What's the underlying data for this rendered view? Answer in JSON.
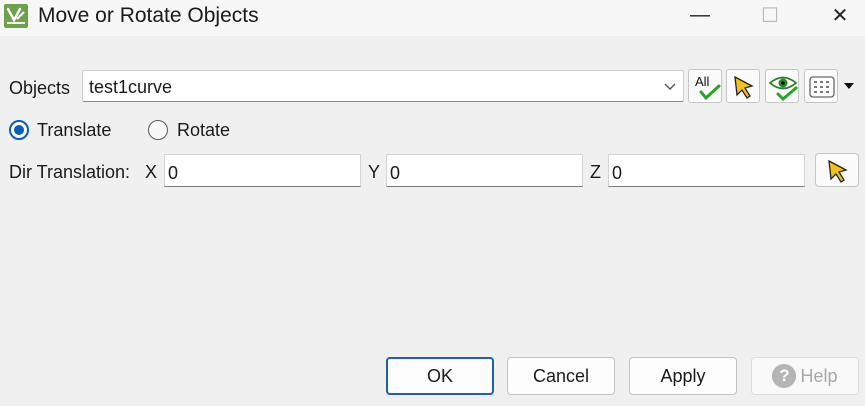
{
  "window": {
    "title": "Move or Rotate Objects",
    "minimize_glyph": "—",
    "maximize_glyph": "☐",
    "close_glyph": "✕"
  },
  "objects": {
    "label": "Objects",
    "value": "test1curve",
    "tool_all_label": "All"
  },
  "mode": {
    "options": [
      {
        "label": "Translate",
        "selected": true
      },
      {
        "label": "Rotate",
        "selected": false
      }
    ]
  },
  "translation": {
    "label": "Dir Translation:",
    "x_label": "X",
    "x_value": "0",
    "y_label": "Y",
    "y_value": "0",
    "z_label": "Z",
    "z_value": "0"
  },
  "buttons": {
    "ok": "OK",
    "cancel": "Cancel",
    "apply": "Apply",
    "help": "Help"
  },
  "colors": {
    "accent": "#0a5fb4",
    "check": "#2aa32a",
    "app_icon": "#6fa04a"
  }
}
